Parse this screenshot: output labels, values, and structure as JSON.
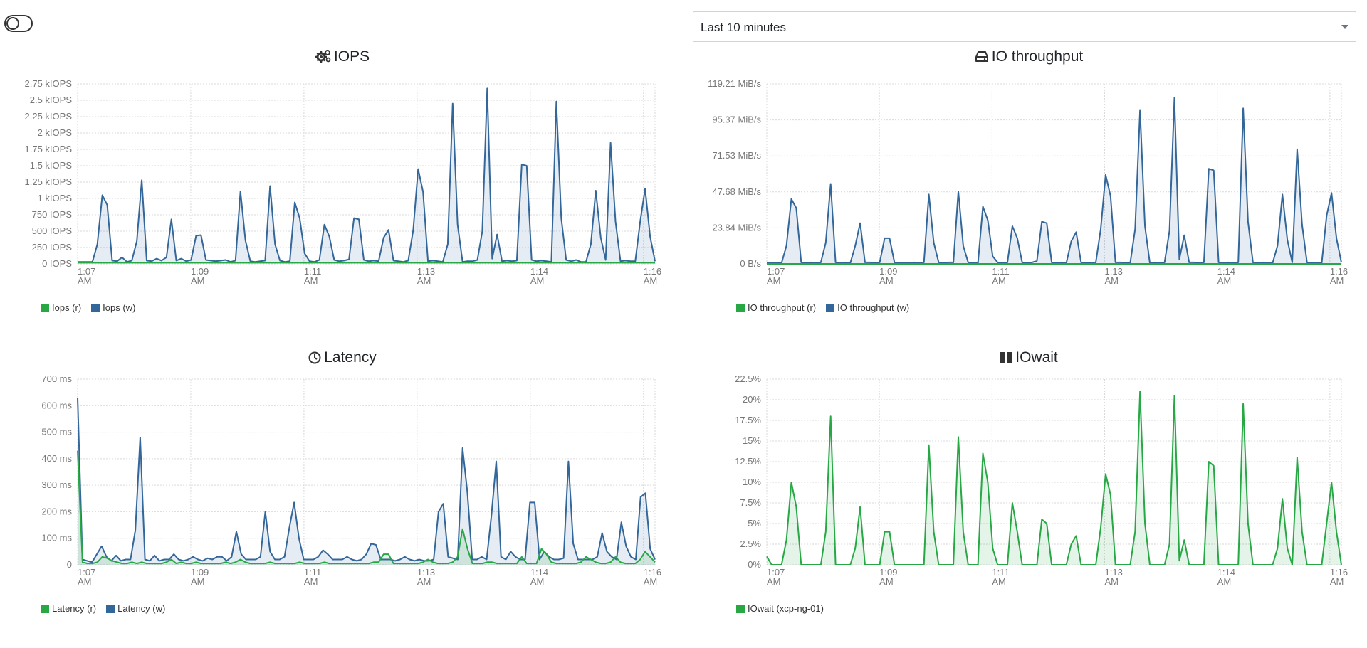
{
  "header": {
    "time_range": "Last 10 minutes"
  },
  "colors": {
    "read": "#28a745",
    "write": "#336699",
    "grid": "#d9d9d9"
  },
  "x_ticks": [
    "1:07",
    "1:09",
    "1:11",
    "1:13",
    "1:14",
    "1:16"
  ],
  "x_tick_suffix": "AM",
  "panels": {
    "iops": {
      "title": "IOPS",
      "icon": "gears-icon",
      "legend": [
        "Iops (r)",
        "Iops (w)"
      ]
    },
    "throughput": {
      "title": "IO throughput",
      "icon": "hdd-icon",
      "legend": [
        "IO throughput (r)",
        "IO throughput (w)"
      ]
    },
    "latency": {
      "title": "Latency",
      "icon": "clock-icon",
      "legend": [
        "Latency (r)",
        "Latency (w)"
      ]
    },
    "iowait": {
      "title": "IOwait",
      "icon": "pause-bars-icon",
      "legend": [
        "IOwait (xcp-ng-01)"
      ]
    }
  },
  "chart_data": [
    {
      "type": "area",
      "title": "IOPS",
      "y_ticks": [
        "2.75 kIOPS",
        "2.5 kIOPS",
        "2.25 kIOPS",
        "2 kIOPS",
        "1.75 kIOPS",
        "1.5 kIOPS",
        "1.25 kIOPS",
        "1 kIOPS",
        "750 IOPS",
        "500 IOPS",
        "250 IOPS",
        "0 IOPS"
      ],
      "ylim": [
        0,
        2750
      ],
      "x_ticks": [
        "1:07 AM",
        "1:09 AM",
        "1:11 AM",
        "1:13 AM",
        "1:14 AM",
        "1:16 AM"
      ],
      "series": [
        {
          "name": "Iops (r)",
          "color": "#28a745",
          "values": [
            20,
            20,
            20,
            20,
            20,
            20,
            20,
            20,
            20,
            20,
            20,
            20,
            20,
            20,
            20,
            20,
            20,
            20,
            20,
            20,
            20,
            20,
            20,
            20,
            20,
            20,
            20,
            20,
            20,
            20,
            20,
            20,
            20,
            20,
            20,
            20,
            20,
            20,
            20,
            20,
            20,
            20,
            20,
            20,
            20,
            20,
            20,
            20,
            20,
            20,
            20,
            20,
            20,
            20,
            20,
            20,
            20,
            20,
            20,
            20,
            20,
            20,
            20,
            20,
            20,
            20,
            20,
            20,
            20,
            20,
            20,
            20,
            20,
            20,
            20,
            20,
            20,
            20,
            20,
            20,
            20,
            20,
            20,
            20,
            20,
            20,
            20,
            20,
            20,
            20,
            20,
            20,
            20,
            20,
            20,
            20,
            20,
            20,
            20,
            20,
            20,
            20,
            20,
            20,
            20,
            20,
            20,
            20,
            20,
            20,
            20,
            20,
            20,
            20,
            20,
            20,
            20,
            20,
            20,
            20
          ]
        },
        {
          "name": "Iops (w)",
          "color": "#336699",
          "values": [
            30,
            30,
            30,
            30,
            300,
            1050,
            900,
            50,
            40,
            100,
            30,
            50,
            350,
            1280,
            50,
            40,
            80,
            50,
            100,
            680,
            50,
            80,
            40,
            60,
            430,
            440,
            60,
            50,
            40,
            50,
            60,
            30,
            50,
            1110,
            360,
            40,
            30,
            40,
            50,
            1190,
            300,
            50,
            30,
            40,
            940,
            700,
            160,
            40,
            30,
            60,
            600,
            420,
            60,
            40,
            50,
            70,
            700,
            680,
            60,
            40,
            50,
            40,
            400,
            520,
            50,
            40,
            30,
            50,
            520,
            1450,
            1100,
            40,
            50,
            40,
            30,
            300,
            2450,
            600,
            30,
            40,
            40,
            60,
            500,
            2680,
            80,
            450,
            40,
            50,
            40,
            50,
            1520,
            1500,
            60,
            40,
            50,
            40,
            30,
            2480,
            700,
            60,
            40,
            60,
            30,
            30,
            300,
            1120,
            400,
            60,
            1850,
            650,
            40,
            50,
            40,
            40,
            650,
            1150,
            420,
            40
          ]
        }
      ]
    },
    {
      "type": "area",
      "title": "IO throughput",
      "y_ticks": [
        "119.21 MiB/s",
        "95.37 MiB/s",
        "71.53 MiB/s",
        "47.68 MiB/s",
        "23.84 MiB/s",
        "0 B/s"
      ],
      "ylim": [
        0,
        119.21
      ],
      "x_ticks": [
        "1:07 AM",
        "1:09 AM",
        "1:11 AM",
        "1:13 AM",
        "1:14 AM",
        "1:16 AM"
      ],
      "series": [
        {
          "name": "IO throughput (r)",
          "color": "#28a745",
          "values": [
            0,
            0,
            0,
            0,
            0,
            0,
            0,
            0,
            0,
            0,
            0,
            0,
            0,
            0,
            0,
            0,
            0,
            0,
            0,
            0,
            0,
            0,
            0,
            0,
            0,
            0,
            0,
            0,
            0,
            0,
            0,
            0,
            0,
            0,
            0,
            0,
            0,
            0,
            0,
            0,
            0,
            0,
            0,
            0,
            0,
            0,
            0,
            0,
            0,
            0,
            0,
            0,
            0,
            0,
            0,
            0,
            0,
            0,
            0,
            0,
            0,
            0,
            0,
            0,
            0,
            0,
            0,
            0,
            0,
            0,
            0,
            0,
            0,
            0,
            0,
            0,
            0,
            0,
            0,
            0,
            0,
            0,
            0,
            0,
            0,
            0,
            0,
            0,
            0,
            0,
            0,
            0,
            0,
            0,
            0,
            0,
            0,
            0,
            0,
            0,
            0,
            0,
            0,
            0,
            0,
            0,
            0,
            0,
            0,
            0,
            0,
            0,
            0,
            0,
            0,
            0,
            0,
            0,
            0,
            0
          ]
        },
        {
          "name": "IO throughput (w)",
          "color": "#336699",
          "values": [
            0.5,
            0.5,
            0.5,
            0.5,
            12,
            43,
            37,
            1,
            0.5,
            1,
            0.5,
            1,
            14,
            53,
            1,
            0.5,
            1,
            0.5,
            12,
            27,
            1,
            1,
            0.5,
            1,
            17,
            17,
            1,
            0.5,
            0.5,
            0.5,
            1,
            0.5,
            1,
            46,
            14,
            1,
            0.5,
            1,
            1,
            48,
            12,
            1,
            0.5,
            0.5,
            38,
            29,
            5,
            1,
            0.5,
            1,
            25,
            17,
            1,
            0.5,
            1,
            2,
            28,
            27,
            1,
            0.5,
            1,
            0.5,
            15,
            21,
            1,
            0.5,
            0.5,
            1,
            23,
            59,
            45,
            1,
            1,
            0.5,
            0.5,
            23,
            102,
            25,
            0.5,
            1,
            0.5,
            1,
            22,
            110,
            3,
            19,
            1,
            1,
            0.5,
            1,
            63,
            62,
            1,
            0.5,
            1,
            0.5,
            1,
            103,
            28,
            1,
            0.5,
            1,
            0.5,
            0.5,
            12,
            46,
            16,
            1,
            76,
            26,
            1,
            0.5,
            0.5,
            0.5,
            32,
            47,
            17,
            1
          ]
        }
      ]
    },
    {
      "type": "area",
      "title": "Latency",
      "y_ticks": [
        "700 ms",
        "600 ms",
        "500 ms",
        "400 ms",
        "300 ms",
        "200 ms",
        "100 ms",
        "0"
      ],
      "ylim": [
        0,
        700
      ],
      "x_ticks": [
        "1:07 AM",
        "1:09 AM",
        "1:11 AM",
        "1:13 AM",
        "1:14 AM",
        "1:16 AM"
      ],
      "series": [
        {
          "name": "Latency (r)",
          "color": "#28a745",
          "values": [
            430,
            10,
            5,
            5,
            10,
            30,
            25,
            15,
            10,
            5,
            5,
            10,
            5,
            10,
            5,
            5,
            5,
            5,
            10,
            20,
            5,
            10,
            5,
            5,
            10,
            5,
            5,
            5,
            5,
            5,
            10,
            5,
            10,
            20,
            10,
            5,
            5,
            5,
            5,
            10,
            5,
            5,
            5,
            5,
            5,
            10,
            5,
            5,
            5,
            5,
            10,
            5,
            5,
            5,
            5,
            5,
            5,
            5,
            5,
            5,
            10,
            10,
            40,
            40,
            5,
            5,
            5,
            5,
            5,
            5,
            10,
            20,
            10,
            5,
            5,
            5,
            10,
            30,
            135,
            60,
            5,
            5,
            5,
            10,
            10,
            5,
            5,
            5,
            5,
            5,
            30,
            5,
            5,
            5,
            60,
            40,
            10,
            5,
            5,
            5,
            5,
            5,
            10,
            30,
            20,
            10,
            5,
            5,
            10,
            30,
            10,
            5,
            5,
            5,
            20,
            50,
            30,
            10
          ]
        },
        {
          "name": "Latency (w)",
          "color": "#336699",
          "values": [
            630,
            20,
            15,
            10,
            40,
            70,
            30,
            15,
            35,
            15,
            20,
            20,
            130,
            480,
            20,
            15,
            35,
            15,
            20,
            20,
            40,
            20,
            15,
            20,
            30,
            20,
            15,
            25,
            20,
            30,
            30,
            15,
            30,
            125,
            40,
            20,
            20,
            20,
            30,
            200,
            50,
            20,
            20,
            30,
            140,
            235,
            100,
            20,
            20,
            20,
            30,
            55,
            40,
            20,
            20,
            20,
            30,
            20,
            15,
            20,
            40,
            80,
            75,
            20,
            20,
            20,
            15,
            20,
            30,
            20,
            15,
            20,
            15,
            15,
            20,
            200,
            230,
            30,
            25,
            20,
            440,
            275,
            20,
            20,
            30,
            20,
            185,
            390,
            30,
            20,
            50,
            30,
            20,
            20,
            235,
            235,
            20,
            50,
            30,
            20,
            20,
            25,
            390,
            80,
            20,
            20,
            20,
            20,
            30,
            120,
            50,
            30,
            20,
            160,
            70,
            30,
            20,
            255,
            270,
            60,
            20
          ]
        }
      ]
    },
    {
      "type": "area",
      "title": "IOwait",
      "y_ticks": [
        "22.5%",
        "20%",
        "17.5%",
        "15%",
        "12.5%",
        "10%",
        "7.5%",
        "5%",
        "2.5%",
        "0%"
      ],
      "ylim": [
        0,
        22.5
      ],
      "x_ticks": [
        "1:07 AM",
        "1:09 AM",
        "1:11 AM",
        "1:13 AM",
        "1:14 AM",
        "1:16 AM"
      ],
      "series": [
        {
          "name": "IOwait (xcp-ng-01)",
          "color": "#28a745",
          "values": [
            1,
            0,
            0,
            0,
            3,
            10,
            7,
            0,
            0,
            0,
            0,
            0,
            4,
            18,
            0,
            0,
            0,
            0,
            2,
            7,
            0,
            0,
            0,
            0,
            4,
            4,
            0,
            0,
            0,
            0,
            0,
            0,
            0,
            14.5,
            4,
            0,
            0,
            0,
            0,
            15.5,
            4,
            0,
            0,
            0,
            13.5,
            10,
            2,
            0,
            0,
            0,
            7.5,
            4,
            0,
            0,
            0,
            0,
            5.5,
            5,
            0,
            0,
            0,
            0,
            2.5,
            3.5,
            0,
            0,
            0,
            0,
            4.5,
            11,
            8.5,
            0,
            0,
            0,
            0,
            4,
            21,
            5,
            0,
            0,
            0,
            0,
            2.5,
            20.5,
            0.5,
            3,
            0,
            0,
            0,
            0,
            12.5,
            12,
            0,
            0,
            0,
            0,
            0,
            19.5,
            5,
            0,
            0,
            0,
            0,
            0,
            2,
            8,
            2,
            0,
            13,
            4,
            0,
            0,
            0,
            0,
            5,
            10,
            4,
            0
          ]
        }
      ]
    }
  ]
}
